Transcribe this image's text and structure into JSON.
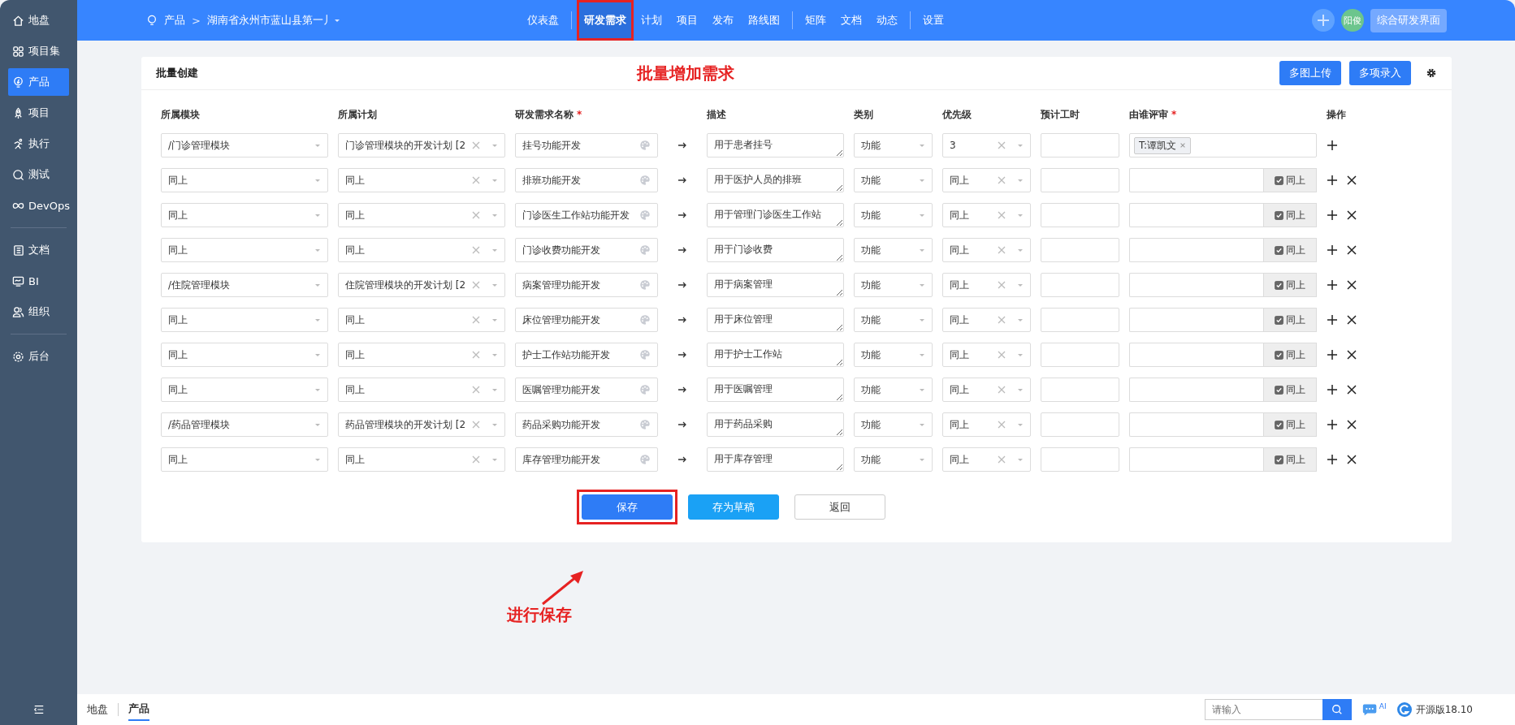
{
  "sidebar": {
    "groups": [
      [
        {
          "label": "地盘",
          "selected": false
        },
        {
          "label": "项目集",
          "selected": false
        },
        {
          "label": "产品",
          "selected": true
        },
        {
          "label": "项目",
          "selected": false
        },
        {
          "label": "执行",
          "selected": false
        },
        {
          "label": "测试",
          "selected": false
        },
        {
          "label": "DevOps",
          "selected": false
        }
      ],
      [
        {
          "label": "文档",
          "selected": false
        },
        {
          "label": "BI",
          "selected": false
        },
        {
          "label": "组织",
          "selected": false
        }
      ],
      [
        {
          "label": "后台",
          "selected": false
        }
      ]
    ]
  },
  "topbar": {
    "breadcrumb": {
      "section": "产品",
      "separator": ">",
      "current": "湖南省永州市蓝山县第一丿"
    },
    "nav_groups": [
      [
        {
          "label": "仪表盘",
          "selected": false,
          "highlighted": false
        }
      ],
      [
        {
          "label": "研发需求",
          "selected": true,
          "highlighted": true
        },
        {
          "label": "计划",
          "selected": false,
          "highlighted": false
        },
        {
          "label": "项目",
          "selected": false,
          "highlighted": false
        },
        {
          "label": "发布",
          "selected": false,
          "highlighted": false
        },
        {
          "label": "路线图",
          "selected": false,
          "highlighted": false
        }
      ],
      [
        {
          "label": "矩阵",
          "selected": false,
          "highlighted": false
        },
        {
          "label": "文档",
          "selected": false,
          "highlighted": false
        },
        {
          "label": "动态",
          "selected": false,
          "highlighted": false
        }
      ],
      [
        {
          "label": "设置",
          "selected": false,
          "highlighted": false
        }
      ]
    ],
    "avatar": "阳俊",
    "view_button": "综合研发界面"
  },
  "card": {
    "title": "批量创建",
    "annotation": "批量增加需求",
    "buttons": [
      "多图上传",
      "多项录入"
    ],
    "columns": [
      {
        "label": "所属模块"
      },
      {
        "label": "所属计划"
      },
      {
        "label": "研发需求名称",
        "mark": "*"
      },
      {
        "label": "描述"
      },
      {
        "label": "类别"
      },
      {
        "label": "优先级"
      },
      {
        "label": "预计工时"
      },
      {
        "label": "由谁评审",
        "mark": "*"
      },
      {
        "label": "操作"
      }
    ],
    "rows": [
      {
        "module": "/门诊管理模块",
        "plan": "门诊管理模块的开发计划 [2",
        "name": "挂号功能开发",
        "description": "用于患者挂号",
        "category": "功能",
        "priority": "3",
        "reviewer": {
          "kind": "tag",
          "text": "T:谭凯文"
        },
        "deletable": false
      },
      {
        "module": "同上",
        "plan": "同上",
        "name": "排班功能开发",
        "description": "用于医护人员的排班",
        "category": "功能",
        "priority": "同上",
        "reviewer": {
          "kind": "same",
          "text": "同上",
          "checked": true
        },
        "deletable": true
      },
      {
        "module": "同上",
        "plan": "同上",
        "name": "门诊医生工作站功能开发",
        "description": "用于管理门诊医生工作站",
        "category": "功能",
        "priority": "同上",
        "reviewer": {
          "kind": "same",
          "text": "同上",
          "checked": true
        },
        "deletable": true
      },
      {
        "module": "同上",
        "plan": "同上",
        "name": "门诊收费功能开发",
        "description": "用于门诊收费",
        "category": "功能",
        "priority": "同上",
        "reviewer": {
          "kind": "same",
          "text": "同上",
          "checked": true
        },
        "deletable": true
      },
      {
        "module": "/住院管理模块",
        "plan": "住院管理模块的开发计划 [2",
        "name": "病案管理功能开发",
        "description": "用于病案管理",
        "category": "功能",
        "priority": "同上",
        "reviewer": {
          "kind": "same",
          "text": "同上",
          "checked": true
        },
        "deletable": true
      },
      {
        "module": "同上",
        "plan": "同上",
        "name": "床位管理功能开发",
        "description": "用于床位管理",
        "category": "功能",
        "priority": "同上",
        "reviewer": {
          "kind": "same",
          "text": "同上",
          "checked": true
        },
        "deletable": true
      },
      {
        "module": "同上",
        "plan": "同上",
        "name": "护士工作站功能开发",
        "description": "用于护士工作站",
        "category": "功能",
        "priority": "同上",
        "reviewer": {
          "kind": "same",
          "text": "同上",
          "checked": true
        },
        "deletable": true
      },
      {
        "module": "同上",
        "plan": "同上",
        "name": "医嘱管理功能开发",
        "description": "用于医嘱管理",
        "category": "功能",
        "priority": "同上",
        "reviewer": {
          "kind": "same",
          "text": "同上",
          "checked": true
        },
        "deletable": true
      },
      {
        "module": "/药品管理模块",
        "plan": "药品管理模块的开发计划 [2",
        "name": "药品采购功能开发",
        "description": "用于药品采购",
        "category": "功能",
        "priority": "同上",
        "reviewer": {
          "kind": "same",
          "text": "同上",
          "checked": true
        },
        "deletable": true
      },
      {
        "module": "同上",
        "plan": "同上",
        "name": "库存管理功能开发",
        "description": "用于库存管理",
        "category": "功能",
        "priority": "同上",
        "reviewer": {
          "kind": "same",
          "text": "同上",
          "checked": true
        },
        "deletable": true
      }
    ],
    "actions": [
      {
        "label": "保存",
        "kind": "primary",
        "highlighted": true
      },
      {
        "label": "存为草稿",
        "kind": "secondary",
        "highlighted": false
      },
      {
        "label": "返回",
        "kind": "plain",
        "highlighted": false
      }
    ],
    "save_note": "进行保存"
  },
  "bottombar": {
    "crumbs": [
      {
        "label": "地盘",
        "selected": false
      },
      {
        "label": "产品",
        "selected": true
      }
    ],
    "search": {
      "placeholder": "请输入"
    },
    "ai_badge": "AI",
    "version": "开源版18.10"
  }
}
